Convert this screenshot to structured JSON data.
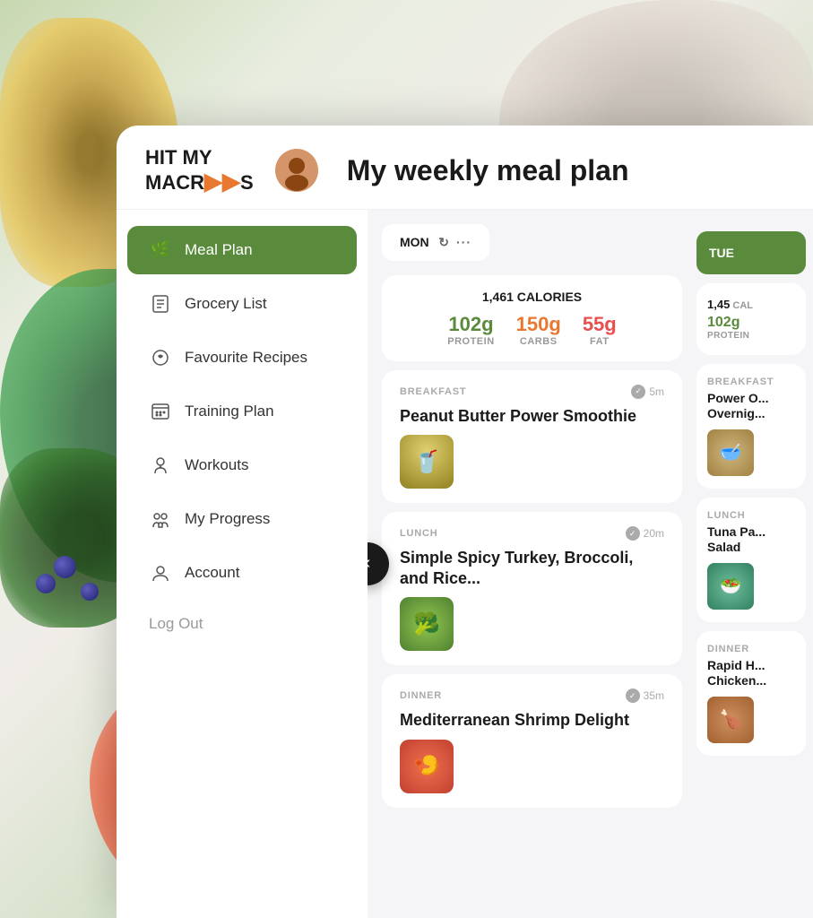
{
  "app": {
    "title": "My weekly meal plan",
    "logo_line1": "HIT MY",
    "logo_line2": "MACR",
    "logo_suffix": "S"
  },
  "nav": {
    "items": [
      {
        "id": "meal-plan",
        "label": "Meal Plan",
        "icon": "🌿",
        "active": true
      },
      {
        "id": "grocery-list",
        "label": "Grocery List",
        "icon": "📋",
        "active": false
      },
      {
        "id": "favourite-recipes",
        "label": "Favourite Recipes",
        "icon": "🍎",
        "active": false
      },
      {
        "id": "training-plan",
        "label": "Training Plan",
        "icon": "📅",
        "active": false
      },
      {
        "id": "workouts",
        "label": "Workouts",
        "icon": "⚡",
        "active": false
      },
      {
        "id": "my-progress",
        "label": "My Progress",
        "icon": "📊",
        "active": false
      },
      {
        "id": "account",
        "label": "Account",
        "icon": "👤",
        "active": false
      }
    ],
    "logout_label": "Log Out"
  },
  "meal_plan": {
    "current_day": {
      "label": "MON",
      "calories": "1,461 CALORIES",
      "protein_value": "102g",
      "protein_label": "PROTEIN",
      "carbs_value": "150g",
      "carbs_label": "CARBS",
      "fat_value": "55g",
      "fat_label": "FAT"
    },
    "meals": [
      {
        "type": "BREAKFAST",
        "time": "5m",
        "name": "Peanut Butter Power Smoothie",
        "thumb_type": "smoothie"
      },
      {
        "type": "LUNCH",
        "time": "20m",
        "name": "Simple Spicy Turkey, Broccoli, and Rice...",
        "thumb_type": "turkey"
      },
      {
        "type": "DINNER",
        "time": "35m",
        "name": "Mediterranean Shrimp Delight",
        "thumb_type": "shrimp"
      }
    ],
    "next_day": {
      "label": "TUE",
      "calories": "1,45",
      "protein_value": "102g",
      "protein_label": "PROTEIN",
      "meals": [
        {
          "type": "BREAKFAST",
          "name": "Power O... Overnig...",
          "thumb_type": "oats"
        },
        {
          "type": "LUNCH",
          "name": "Tuna Pa... Salad",
          "thumb_type": "tuna"
        },
        {
          "type": "DINNER",
          "name": "Rapid H... Chicken...",
          "thumb_type": "chicken"
        }
      ]
    }
  },
  "colors": {
    "green": "#5a8a3c",
    "orange": "#e87830",
    "red": "#e85050",
    "dark": "#1a1a1a",
    "gray_light": "#f5f5f7",
    "gray_text": "#aaaaaa"
  }
}
